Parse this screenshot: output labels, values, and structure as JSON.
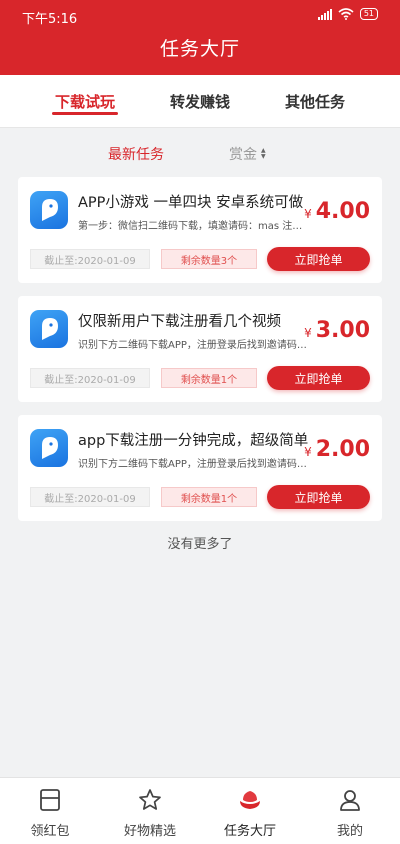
{
  "status_bar": {
    "time": "下午5:16",
    "battery": "51"
  },
  "header": {
    "title": "任务大厅",
    "bg_color": "#d8262b"
  },
  "tabs": [
    {
      "label": "下载试玩",
      "active": true
    },
    {
      "label": "转发赚钱",
      "active": false
    },
    {
      "label": "其他任务",
      "active": false
    }
  ],
  "sort": {
    "latest": "最新任务",
    "reward": "赏金"
  },
  "tasks": [
    {
      "title": "APP小游戏 一单四块 安卓系统可做",
      "desc": "第一步：微信扫二维码下载，填邀请码：mas 注册…",
      "currency": "¥",
      "price": "4.00",
      "deadline": "截止至:2020-01-09",
      "remaining": "剩余数量3个",
      "button": "立即抢单"
    },
    {
      "title": "仅限新用户下载注册看几个视频",
      "desc": "识别下方二维码下载APP，注册登录后找到邀请码…",
      "currency": "¥",
      "price": "3.00",
      "deadline": "截止至:2020-01-09",
      "remaining": "剩余数量1个",
      "button": "立即抢单"
    },
    {
      "title": "app下载注册一分钟完成，超级简单",
      "desc": "识别下方二维码下载APP，注册登录后找到邀请码…",
      "currency": "¥",
      "price": "2.00",
      "deadline": "截止至:2020-01-09",
      "remaining": "剩余数量1个",
      "button": "立即抢单"
    }
  ],
  "footer_text": "没有更多了",
  "bottom_nav": [
    {
      "label": "领红包",
      "icon": "wallet-icon",
      "active": false
    },
    {
      "label": "好物精选",
      "icon": "star-icon",
      "active": false
    },
    {
      "label": "任务大厅",
      "icon": "lotus-icon",
      "active": true
    },
    {
      "label": "我的",
      "icon": "user-icon",
      "active": false
    }
  ]
}
